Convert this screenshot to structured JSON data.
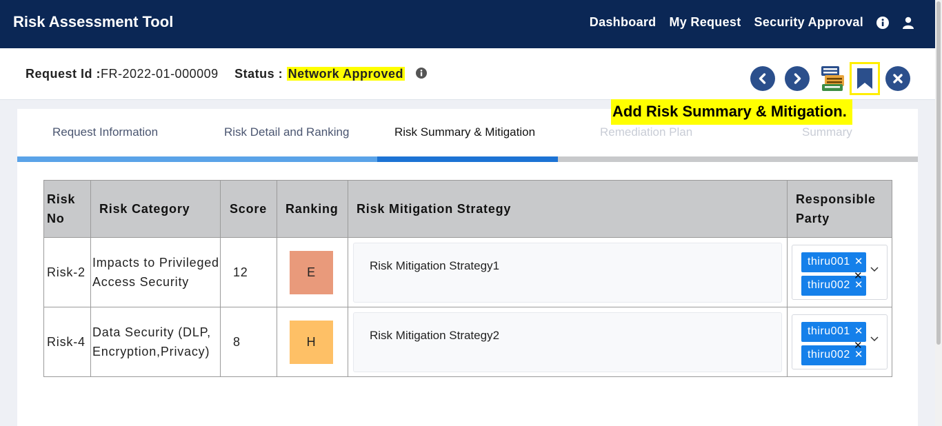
{
  "app": {
    "title": "Risk Assessment Tool",
    "nav": [
      "Dashboard",
      "My Request",
      "Security Approval"
    ]
  },
  "request": {
    "id_label": "Request Id :",
    "id_value": "FR-2022-01-000009",
    "status_label": "Status :",
    "status_value": "Network Approved"
  },
  "tooltip": "Add Risk Summary & Mitigation.",
  "tabs": [
    {
      "label": "Request Information",
      "state": "done"
    },
    {
      "label": "Risk Detail and Ranking",
      "state": "done"
    },
    {
      "label": "Risk Summary & Mitigation",
      "state": "active"
    },
    {
      "label": "Remediation Plan",
      "state": "disabled"
    },
    {
      "label": "Summary",
      "state": "disabled"
    }
  ],
  "table": {
    "headers": [
      "Risk No",
      "Risk Category",
      "Score",
      "Ranking",
      "Risk Mitigation Strategy",
      "Responsible Party"
    ],
    "rows": [
      {
        "risk_no": "Risk-2",
        "category": "Impacts to Privileged Access Security",
        "score": "12",
        "ranking": "E",
        "ranking_color": "#e99a7b",
        "strategy": "Risk Mitigation Strategy1",
        "parties": [
          "thiru001",
          "thiru002"
        ]
      },
      {
        "risk_no": "Risk-4",
        "category": "Data Security (DLP, Encryption,Privacy)",
        "score": "8",
        "ranking": "H",
        "ranking_color": "#fec066",
        "strategy": "Risk Mitigation Strategy2",
        "parties": [
          "thiru001",
          "thiru002"
        ]
      }
    ]
  },
  "colors": {
    "nav_bg": "#0b2755",
    "progress_done": "#5aa3e8",
    "progress_active": "#1c73d4",
    "progress_todo": "#c8c9cb",
    "chip": "#1580ea",
    "highlight": "#ffff00"
  },
  "icons": [
    "info-icon",
    "user-icon",
    "prev-icon",
    "next-icon",
    "forms-icon",
    "bookmark-icon",
    "close-icon"
  ]
}
